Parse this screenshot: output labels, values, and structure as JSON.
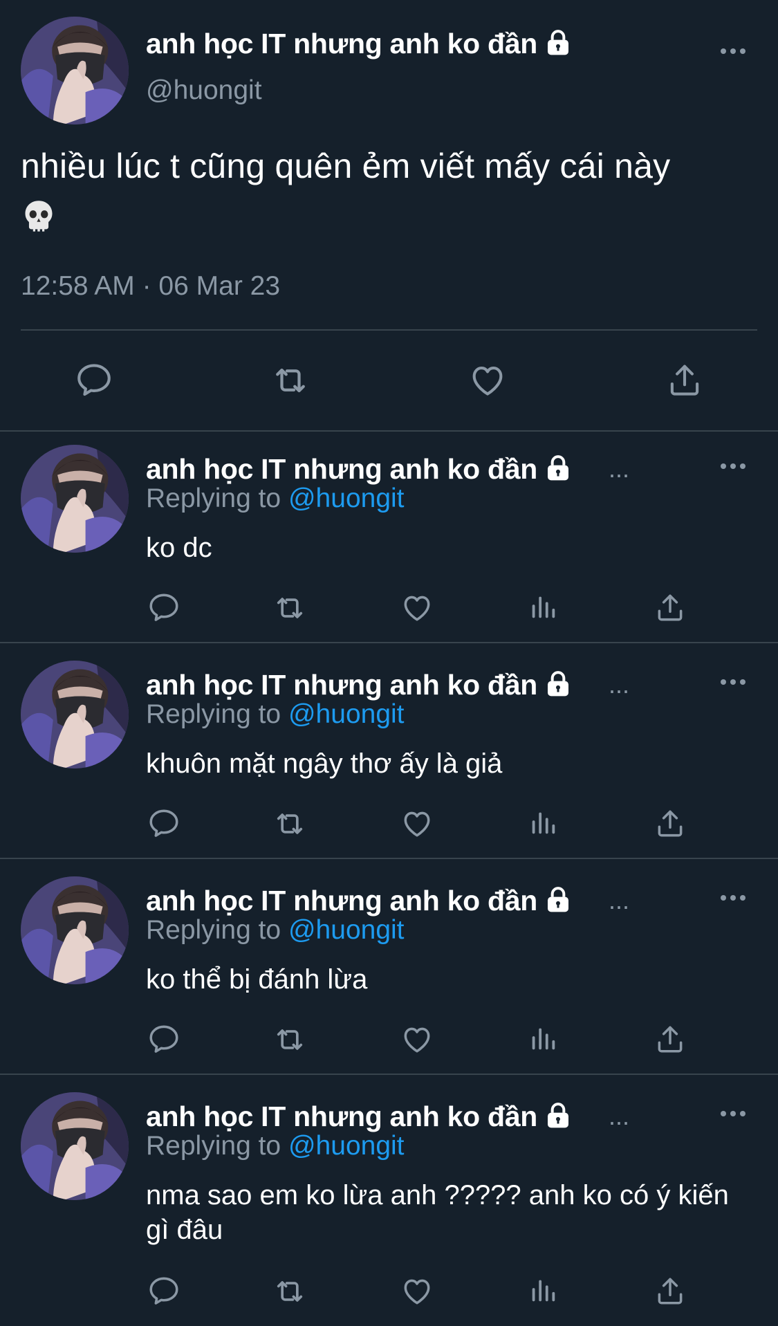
{
  "colors": {
    "background": "#15202b",
    "text": "#ffffff",
    "muted": "#8b98a5",
    "link": "#1d9bf0",
    "divider": "#38444d"
  },
  "main_tweet": {
    "display_name": "anh học IT nhưng anh ko đần",
    "handle": "@huongit",
    "text": "nhiều lúc t cũng quên ẻm viết mấy cái này",
    "emoji": "💀",
    "timestamp": "12:58 AM · 06 Mar 23",
    "actions": [
      "reply-icon",
      "retweet-icon",
      "like-icon",
      "share-icon"
    ]
  },
  "replies": [
    {
      "display_name": "anh học IT nhưng anh ko đần",
      "ellipsis": "...",
      "replying_prefix": "Replying to",
      "replying_handle": "@huongit",
      "text": "ko dc"
    },
    {
      "display_name": "anh học IT nhưng anh ko đần",
      "ellipsis": "...",
      "replying_prefix": "Replying to",
      "replying_handle": "@huongit",
      "text": "khuôn mặt ngây thơ ấy là giả"
    },
    {
      "display_name": "anh học IT nhưng anh ko đần",
      "ellipsis": "...",
      "replying_prefix": "Replying to",
      "replying_handle": "@huongit",
      "text": "ko thể bị đánh lừa"
    },
    {
      "display_name": "anh học IT nhưng anh ko đần",
      "ellipsis": "...",
      "replying_prefix": "Replying to",
      "replying_handle": "@huongit",
      "text": "nma sao em ko lừa anh ????? anh ko có ý kiến gì đâu"
    }
  ],
  "reply_actions": [
    "reply-icon",
    "retweet-icon",
    "like-icon",
    "analytics-icon",
    "share-icon"
  ]
}
